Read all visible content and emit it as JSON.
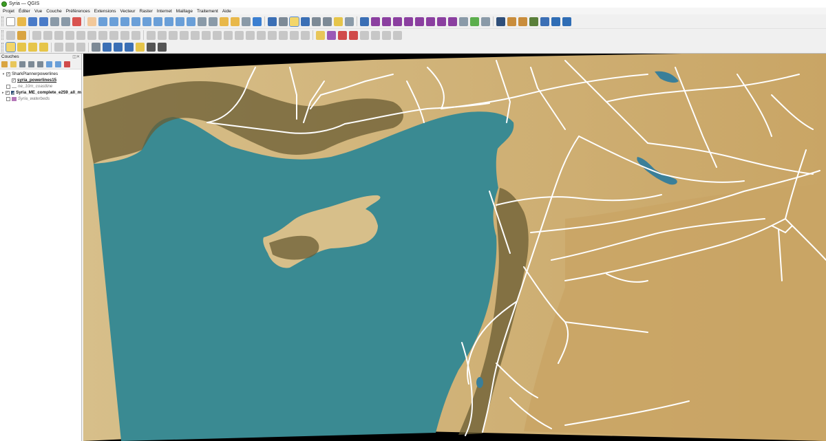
{
  "window": {
    "title": "Syria — QGIS"
  },
  "menu": [
    "Projet",
    "Éditer",
    "Vue",
    "Couche",
    "Préférences",
    "Extensions",
    "Vecteur",
    "Raster",
    "Internet",
    "Maillage",
    "Traitement",
    "Aide"
  ],
  "layers_panel": {
    "title": "Couches",
    "layers": [
      {
        "name": "SharkPlannerpowerlines",
        "checked": true,
        "style": "normal",
        "expander": "▾",
        "indent": 0,
        "symbol": "none"
      },
      {
        "name": "syria_powerlines15",
        "checked": true,
        "style": "underline",
        "expander": "",
        "indent": 1,
        "symbol": "none"
      },
      {
        "name": "ne_10m_coastline",
        "checked": false,
        "style": "italic",
        "expander": "",
        "indent": 0,
        "symbol": "line"
      },
      {
        "name": "Syria_ME_complete_e259_all_m",
        "checked": true,
        "style": "bold",
        "expander": "▸",
        "indent": 0,
        "symbol": "raster"
      },
      {
        "name": "Syria_waterbeds",
        "checked": false,
        "style": "italic",
        "expander": "",
        "indent": 0,
        "symbol": "fill"
      }
    ]
  },
  "icons": {
    "toolbar1": [
      {
        "name": "new-project-icon",
        "color": "#ffffff"
      },
      {
        "name": "open-project-icon",
        "color": "#e8b84a"
      },
      {
        "name": "save-project-icon",
        "color": "#4a7bc8"
      },
      {
        "name": "save-as-icon",
        "color": "#4a7bc8"
      },
      {
        "name": "new-print-layout-icon",
        "color": "#8a9aa8"
      },
      {
        "name": "layout-manager-icon",
        "color": "#8a9aa8"
      },
      {
        "name": "style-manager-icon",
        "color": "#d9534f"
      },
      {
        "name": "sep",
        "color": ""
      },
      {
        "name": "pan-icon",
        "color": "#f2c89a"
      },
      {
        "name": "pan-to-selection-icon",
        "color": "#6a9fd8"
      },
      {
        "name": "zoom-in-icon",
        "color": "#6a9fd8"
      },
      {
        "name": "zoom-out-icon",
        "color": "#6a9fd8"
      },
      {
        "name": "zoom-full-icon",
        "color": "#6a9fd8"
      },
      {
        "name": "zoom-selection-icon",
        "color": "#6a9fd8"
      },
      {
        "name": "zoom-layer-icon",
        "color": "#6a9fd8"
      },
      {
        "name": "zoom-native-icon",
        "color": "#6a9fd8"
      },
      {
        "name": "zoom-last-icon",
        "color": "#6a9fd8"
      },
      {
        "name": "zoom-next-icon",
        "color": "#6a9fd8"
      },
      {
        "name": "new-map-view-icon",
        "color": "#8a9aa8"
      },
      {
        "name": "new-3d-view-icon",
        "color": "#8a9aa8"
      },
      {
        "name": "bookmark-new-icon",
        "color": "#e8b84a"
      },
      {
        "name": "bookmark-show-icon",
        "color": "#e8b84a"
      },
      {
        "name": "temporal-controller-icon",
        "color": "#8a9aa8"
      },
      {
        "name": "refresh-icon",
        "color": "#3b7fd1"
      },
      {
        "name": "sep",
        "color": ""
      },
      {
        "name": "identify-icon",
        "color": "#3b6fb5"
      },
      {
        "name": "open-attribute-table-icon",
        "color": "#7d8a96"
      },
      {
        "name": "select-features-icon",
        "color": "#e6c54a"
      },
      {
        "name": "statistics-icon",
        "color": "#3b6fb5"
      },
      {
        "name": "field-calculator-icon",
        "color": "#7d8a96"
      },
      {
        "name": "measure-icon",
        "color": "#7d8a96"
      },
      {
        "name": "map-tips-icon",
        "color": "#e6c54a"
      },
      {
        "name": "annotations-icon",
        "color": "#8a9aa8"
      },
      {
        "name": "sep",
        "color": ""
      },
      {
        "name": "python-console-icon",
        "color": "#3b6fb5"
      },
      {
        "name": "plugin-a-icon",
        "color": "#8b3fa0"
      },
      {
        "name": "plugin-b-icon",
        "color": "#8b3fa0"
      },
      {
        "name": "plugin-c-icon",
        "color": "#8b3fa0"
      },
      {
        "name": "plugin-d-icon",
        "color": "#8b3fa0"
      },
      {
        "name": "plugin-e-icon",
        "color": "#8b3fa0"
      },
      {
        "name": "plugin-f-icon",
        "color": "#8b3fa0"
      },
      {
        "name": "plugin-g-icon",
        "color": "#8b3fa0"
      },
      {
        "name": "plugin-h-icon",
        "color": "#8b3fa0"
      },
      {
        "name": "plugin-i-icon",
        "color": "#8a9aa8"
      },
      {
        "name": "plugin-j-icon",
        "color": "#5cae4d"
      },
      {
        "name": "grid-icon",
        "color": "#8a9aa8"
      },
      {
        "name": "sep",
        "color": ""
      },
      {
        "name": "db-manager-icon",
        "color": "#2f4f7a"
      },
      {
        "name": "package-icon",
        "color": "#c98d3c"
      },
      {
        "name": "package-b-icon",
        "color": "#c98d3c"
      },
      {
        "name": "vector-tools-icon",
        "color": "#5a7f3a"
      },
      {
        "name": "plugin-k-icon",
        "color": "#3b6fb5"
      },
      {
        "name": "plugin-l-icon",
        "color": "#2f6db5"
      },
      {
        "name": "check-geometry-icon",
        "color": "#2f6db5"
      }
    ],
    "toolbar2": [
      {
        "name": "current-edits-icon",
        "color": "#c7c7c7"
      },
      {
        "name": "toggle-editing-icon",
        "color": "#d9a441"
      },
      {
        "name": "sep",
        "color": ""
      },
      {
        "name": "save-edits-icon",
        "color": "#c7c7c7"
      },
      {
        "name": "digitize-icon",
        "color": "#c7c7c7"
      },
      {
        "name": "add-feature-icon",
        "color": "#c7c7c7"
      },
      {
        "name": "vertex-tool-icon",
        "color": "#c7c7c7"
      },
      {
        "name": "delete-selected-icon",
        "color": "#c7c7c7"
      },
      {
        "name": "cut-icon",
        "color": "#c7c7c7"
      },
      {
        "name": "copy-icon",
        "color": "#c7c7c7"
      },
      {
        "name": "paste-icon",
        "color": "#c7c7c7"
      },
      {
        "name": "undo-icon",
        "color": "#c7c7c7"
      },
      {
        "name": "redo-icon",
        "color": "#c7c7c7"
      },
      {
        "name": "sep",
        "color": ""
      },
      {
        "name": "advanced-digitize-icon",
        "color": "#c7c7c7"
      },
      {
        "name": "rotate-feature-icon",
        "color": "#c7c7c7"
      },
      {
        "name": "simplify-icon",
        "color": "#c7c7c7"
      },
      {
        "name": "add-ring-icon",
        "color": "#c7c7c7"
      },
      {
        "name": "add-part-icon",
        "color": "#c7c7c7"
      },
      {
        "name": "fill-ring-icon",
        "color": "#c7c7c7"
      },
      {
        "name": "delete-ring-icon",
        "color": "#c7c7c7"
      },
      {
        "name": "delete-part-icon",
        "color": "#c7c7c7"
      },
      {
        "name": "reshape-icon",
        "color": "#c7c7c7"
      },
      {
        "name": "offset-curve-icon",
        "color": "#c7c7c7"
      },
      {
        "name": "split-features-icon",
        "color": "#c7c7c7"
      },
      {
        "name": "split-parts-icon",
        "color": "#c7c7c7"
      },
      {
        "name": "merge-features-icon",
        "color": "#c7c7c7"
      },
      {
        "name": "merge-attributes-icon",
        "color": "#c7c7c7"
      },
      {
        "name": "rotate-point-icon",
        "color": "#c7c7c7"
      },
      {
        "name": "sep",
        "color": ""
      },
      {
        "name": "label-pin-icon",
        "color": "#e8c65a"
      },
      {
        "name": "label-show-icon",
        "color": "#9b59b6"
      },
      {
        "name": "label-move-icon",
        "color": "#d04a4a"
      },
      {
        "name": "label-rotate-icon",
        "color": "#d04a4a"
      },
      {
        "name": "label-change-icon",
        "color": "#c7c7c7"
      },
      {
        "name": "label-diagram-icon",
        "color": "#c7c7c7"
      },
      {
        "name": "label-pin-b-icon",
        "color": "#c7c7c7"
      },
      {
        "name": "label-pin-c-icon",
        "color": "#c7c7c7"
      }
    ],
    "toolbar3": [
      {
        "name": "snapping-icon",
        "color": "#e6c54a"
      },
      {
        "name": "layer-style-icon",
        "color": "#e6c54a"
      },
      {
        "name": "select-by-expression-icon",
        "color": "#e6c54a"
      },
      {
        "name": "deselect-icon",
        "color": "#e6c54a"
      },
      {
        "name": "sep",
        "color": ""
      },
      {
        "name": "add-feature-b-icon",
        "color": "#c7c7c7"
      },
      {
        "name": "add-feature-c-icon",
        "color": "#c7c7c7"
      },
      {
        "name": "add-feature-d-icon",
        "color": "#c7c7c7"
      },
      {
        "name": "sep",
        "color": ""
      },
      {
        "name": "text-annotation-icon",
        "color": "#7d8a96"
      },
      {
        "name": "select-annotation-icon",
        "color": "#3b6fb5"
      },
      {
        "name": "move-annotation-icon",
        "color": "#3b6fb5"
      },
      {
        "name": "node-tool-icon",
        "color": "#3b6fb5"
      },
      {
        "name": "label-icon",
        "color": "#e6c54a"
      },
      {
        "name": "label-text-icon",
        "color": "#555555"
      },
      {
        "name": "text-format-icon",
        "color": "#555555"
      }
    ]
  },
  "map": {
    "colors": {
      "sea": "#3a8a92",
      "land_low": "#d7bf8a",
      "land_desert": "#c9a565",
      "land_green": "#6f6e3a",
      "mountains": "#6a5c33",
      "powerline": "#ffffff",
      "lake": "#3a7f99",
      "nodata": "#000000"
    }
  }
}
